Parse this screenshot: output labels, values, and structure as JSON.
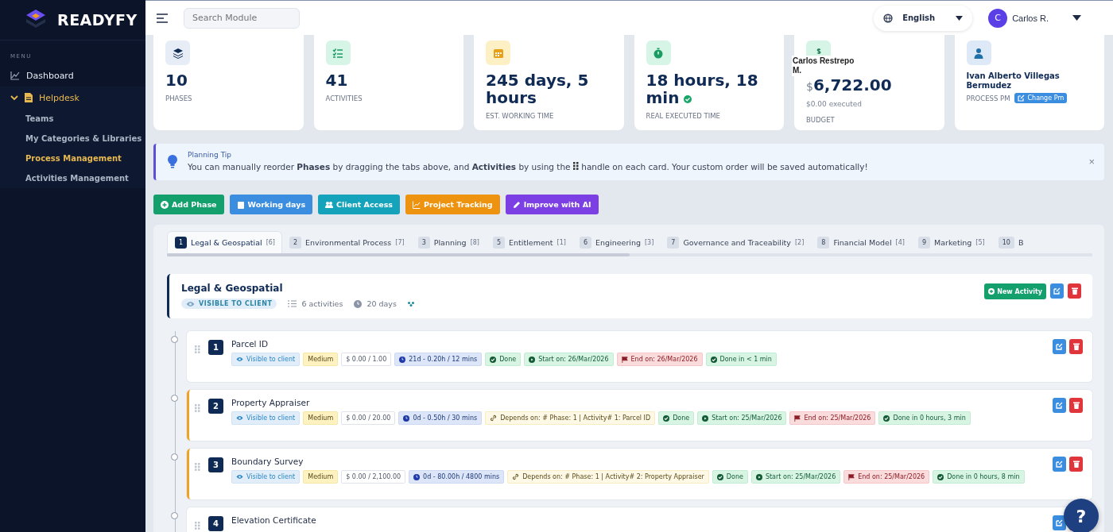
{
  "brand": {
    "name": "READYFY"
  },
  "sidebar": {
    "section": "MENU",
    "items": [
      {
        "label": "Dashboard",
        "expanded": false
      },
      {
        "label": "Helpdesk",
        "expanded": true,
        "children": [
          {
            "label": "Teams",
            "selected": false
          },
          {
            "label": "My Categories & Libraries",
            "selected": false
          },
          {
            "label": "Process Management",
            "selected": true
          },
          {
            "label": "Activities Management",
            "selected": false
          }
        ]
      }
    ]
  },
  "topbar": {
    "search": {
      "placeholder": "Search Module"
    },
    "language": "English",
    "user": {
      "initial": "C",
      "name": "Carlos R."
    }
  },
  "stats": [
    {
      "value": "10",
      "label": "PHASES"
    },
    {
      "value": "41",
      "label": "ACTIVITIES"
    },
    {
      "value": "245 days, 5 hours",
      "label": "EST. WORKING TIME"
    },
    {
      "value": "18 hours, 18 min",
      "label": "REAL EXECUTED TIME",
      "done": true
    },
    {
      "currency": "$",
      "value": "6,722.00",
      "note": "$0.00 executed",
      "label": "BUDGET",
      "tooltip": "Carlos Restrepo M."
    },
    {
      "name": "Ivan Alberto Villegas Bermudez",
      "label": "PROCESS PM",
      "button": "Change Pm"
    }
  ],
  "tip": {
    "title": "Planning Tip",
    "text": "You can manually reorder **Phases** by dragging the tabs above, and **Activities** by using the",
    "text_after": "handle on each card. Your custom order will be saved automatically!",
    "close": "×"
  },
  "actions": [
    {
      "kind": "add",
      "label": "Add Phase",
      "color": "#13a06d"
    },
    {
      "kind": "calendar",
      "label": "Working days",
      "color": "#3b8ddf"
    },
    {
      "kind": "users",
      "label": "Client Access",
      "color": "#14a3ba"
    },
    {
      "kind": "chart",
      "label": "Project Tracking",
      "color": "#ee930f"
    },
    {
      "kind": "pen",
      "label": "Improve with AI",
      "color": "#7b3fe4"
    }
  ],
  "tabs": [
    {
      "number": "1",
      "label": "Legal & Geospatial",
      "count": "[6]",
      "selected": true
    },
    {
      "number": "2",
      "label": "Environmental Process",
      "count": "[7]",
      "selected": false
    },
    {
      "number": "3",
      "label": "Planning",
      "count": "[8]",
      "selected": false
    },
    {
      "number": "5",
      "label": "Entitlement",
      "count": "[1]",
      "selected": false
    },
    {
      "number": "6",
      "label": "Engineering",
      "count": "[3]",
      "selected": false
    },
    {
      "number": "7",
      "label": "Governance and Traceability",
      "count": "[2]",
      "selected": false
    },
    {
      "number": "8",
      "label": "Financial Model",
      "count": "[4]",
      "selected": false
    },
    {
      "number": "9",
      "label": "Marketing",
      "count": "[5]",
      "selected": false
    },
    {
      "number": "10",
      "label": "B",
      "selected": false
    }
  ],
  "phase": {
    "title": "Legal & Geospatial",
    "visibility": "VISIBLE TO CLIENT",
    "activities": "6 activities",
    "duration": "20 days",
    "new_button": "New Activity"
  },
  "activities": [
    {
      "number": "1",
      "title": "Parcel ID",
      "flagged": false,
      "tags": [
        {
          "kind": "visible",
          "text": "Visible to client"
        },
        {
          "kind": "priority",
          "text": "Medium"
        },
        {
          "kind": "cost",
          "text": "$ 0.00 / 1.00"
        },
        {
          "kind": "duration",
          "text": "21d - 0.20h / 12 mins"
        },
        {
          "kind": "status",
          "text": "Done"
        },
        {
          "kind": "start",
          "text": "Start on: 26/Mar/2026"
        },
        {
          "kind": "end",
          "text": "End on: 26/Mar/2026"
        },
        {
          "kind": "done",
          "text": "Done in < 1 min"
        }
      ]
    },
    {
      "number": "2",
      "title": "Property Appraiser",
      "flagged": true,
      "tags": [
        {
          "kind": "visible",
          "text": "Visible to client"
        },
        {
          "kind": "priority",
          "text": "Medium"
        },
        {
          "kind": "cost",
          "text": "$ 0.00 / 20.00"
        },
        {
          "kind": "duration",
          "text": "0d - 0.50h / 30 mins"
        },
        {
          "kind": "depends",
          "text": "Depends on: # Phase: 1 | Activity# 1: Parcel ID"
        },
        {
          "kind": "status",
          "text": "Done"
        },
        {
          "kind": "start",
          "text": "Start on: 25/Mar/2026"
        },
        {
          "kind": "end",
          "text": "End on: 25/Mar/2026"
        },
        {
          "kind": "done",
          "text": "Done in 0 hours, 3 min"
        }
      ]
    },
    {
      "number": "3",
      "title": "Boundary Survey",
      "flagged": true,
      "tags": [
        {
          "kind": "visible",
          "text": "Visible to client"
        },
        {
          "kind": "priority",
          "text": "Medium"
        },
        {
          "kind": "cost",
          "text": "$ 0.00 / 2,100.00"
        },
        {
          "kind": "duration",
          "text": "0d - 80.00h / 4800 mins"
        },
        {
          "kind": "depends",
          "text": "Depends on: # Phase: 1 | Activity# 2: Property Appraiser"
        },
        {
          "kind": "status",
          "text": "Done"
        },
        {
          "kind": "start",
          "text": "Start on: 25/Mar/2026"
        },
        {
          "kind": "end",
          "text": "End on: 25/Mar/2026"
        },
        {
          "kind": "done",
          "text": "Done in 0 hours, 8 min"
        }
      ]
    },
    {
      "number": "4",
      "title": "Elevation Certificate",
      "flagged": false
    }
  ],
  "help": {
    "label": "?"
  }
}
